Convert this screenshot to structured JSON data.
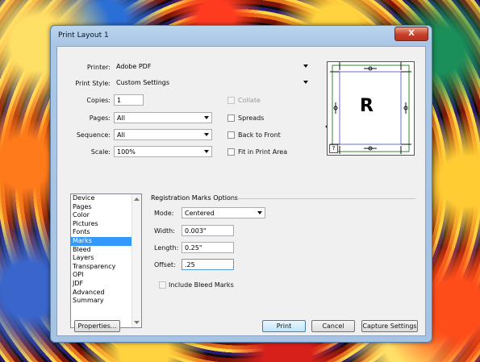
{
  "window": {
    "title": "Print Layout 1",
    "close_label": "X"
  },
  "form": {
    "printer_label": "Printer:",
    "printer_value": "Adobe PDF",
    "print_style_label": "Print Style:",
    "print_style_value": "Custom Settings",
    "copies_label": "Copies:",
    "copies_value": "1",
    "pages_label": "Pages:",
    "pages_value": "All",
    "sequence_label": "Sequence:",
    "sequence_value": "All",
    "scale_label": "Scale:",
    "scale_value": "100%",
    "collate_label": "Collate",
    "collate_checked": false,
    "collate_enabled": false,
    "spreads_label": "Spreads",
    "spreads_checked": false,
    "back_to_front_label": "Back to Front",
    "back_to_front_checked": false,
    "fit_label": "Fit in Print Area",
    "fit_checked": false
  },
  "preview": {
    "letter": "R",
    "help_label": "?"
  },
  "sidebar": {
    "items": [
      "Device",
      "Pages",
      "Color",
      "Pictures",
      "Fonts",
      "Marks",
      "Bleed",
      "Layers",
      "Transparency",
      "OPI",
      "JDF",
      "Advanced",
      "Summary"
    ],
    "selected": "Marks"
  },
  "marks": {
    "group_label": "Registration Marks Options",
    "mode_label": "Mode:",
    "mode_value": "Centered",
    "width_label": "Width:",
    "width_value": "0.003\"",
    "length_label": "Length:",
    "length_value": "0.25\"",
    "offset_label": "Offset:",
    "offset_value": ".25",
    "include_bleed_label": "Include Bleed Marks",
    "include_bleed_checked": false
  },
  "buttons": {
    "properties": "Properties...",
    "print": "Print",
    "cancel": "Cancel",
    "capture": "Capture Settings"
  },
  "colors": {
    "selection": "#3399ff",
    "frame": "#a6c3e3",
    "preview_inner_border": "#2c8a2c",
    "preview_page_border": "#6b6bcc"
  }
}
